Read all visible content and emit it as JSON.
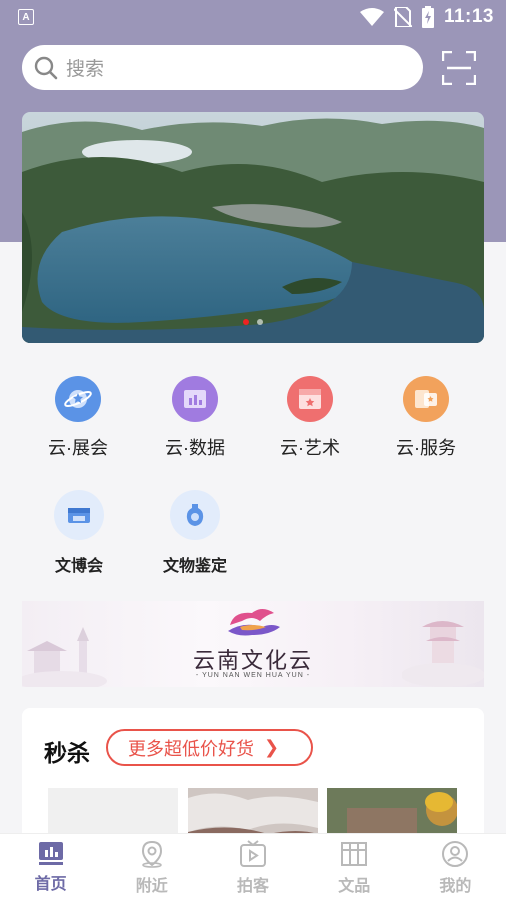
{
  "status_bar": {
    "time": "11:13",
    "indicator": "A"
  },
  "search": {
    "placeholder": "搜索",
    "scan_icon": "scan-icon"
  },
  "banner": {
    "page_count": 2,
    "active_index": 0
  },
  "grid": {
    "items": [
      {
        "label": "云·展会",
        "icon": "planet-icon",
        "color": "#5b93e6"
      },
      {
        "label": "云·数据",
        "icon": "bar-chart-icon",
        "color": "#a07be0"
      },
      {
        "label": "云·艺术",
        "icon": "art-board-icon",
        "color": "#ef6f6f"
      },
      {
        "label": "云·服务",
        "icon": "service-card-icon",
        "color": "#f2a25c"
      },
      {
        "label": "文博会",
        "icon": "expo-hall-icon",
        "color": "#5b93e6"
      },
      {
        "label": "文物鉴定",
        "icon": "vase-icon",
        "color": "#5b93e6"
      }
    ]
  },
  "promo": {
    "title": "云南文化云",
    "subtitle": "- YUN NAN WEN HUA YUN -"
  },
  "flash_sale": {
    "title": "秒杀",
    "more_label": "更多超低价好货",
    "accent": "#e9534a"
  },
  "tabs": [
    {
      "label": "首页",
      "icon": "home-chart-icon",
      "active": true
    },
    {
      "label": "附近",
      "icon": "location-pin-icon",
      "active": false
    },
    {
      "label": "拍客",
      "icon": "video-play-icon",
      "active": false
    },
    {
      "label": "文品",
      "icon": "shop-icon",
      "active": false
    },
    {
      "label": "我的",
      "icon": "user-icon",
      "active": false
    }
  ],
  "colors": {
    "header": "#9b96b8",
    "active_tab": "#6d6aa6",
    "inactive_tab": "#b9b9b9"
  }
}
